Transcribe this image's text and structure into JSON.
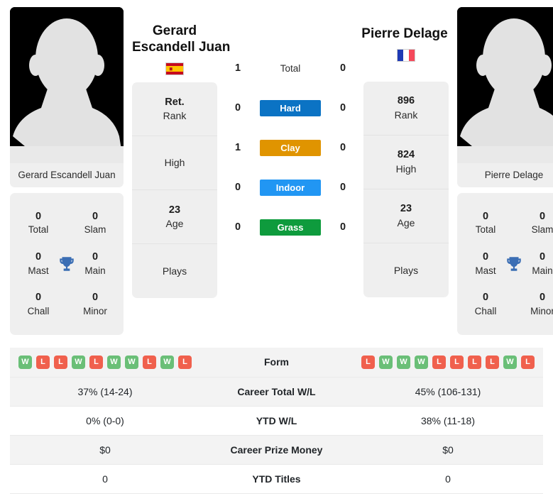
{
  "players": {
    "left": {
      "name_lines": [
        "Gerard",
        "Escandell Juan"
      ],
      "photo_caption": "Gerard Escandell Juan",
      "country": "Spain",
      "flag_icon": "spain-flag-icon",
      "rank_value": "Ret.",
      "rank_label": "Rank",
      "high_value": "",
      "high_label": "High",
      "age_value": "23",
      "age_label": "Age",
      "plays_value": "",
      "plays_label": "Plays",
      "titles": [
        {
          "num": "0",
          "label": "Total"
        },
        {
          "num": "0",
          "label": "Slam"
        },
        {
          "num": "0",
          "label": "Mast"
        },
        {
          "num": "0",
          "label": "Main"
        },
        {
          "num": "0",
          "label": "Chall"
        },
        {
          "num": "0",
          "label": "Minor"
        }
      ],
      "form": [
        "W",
        "L",
        "L",
        "W",
        "L",
        "W",
        "W",
        "L",
        "W",
        "L"
      ]
    },
    "right": {
      "name_lines": [
        "Pierre Delage"
      ],
      "photo_caption": "Pierre Delage",
      "country": "France",
      "flag_icon": "france-flag-icon",
      "rank_value": "896",
      "rank_label": "Rank",
      "high_value": "824",
      "high_label": "High",
      "age_value": "23",
      "age_label": "Age",
      "plays_value": "",
      "plays_label": "Plays",
      "titles": [
        {
          "num": "0",
          "label": "Total"
        },
        {
          "num": "0",
          "label": "Slam"
        },
        {
          "num": "0",
          "label": "Mast"
        },
        {
          "num": "0",
          "label": "Main"
        },
        {
          "num": "0",
          "label": "Chall"
        },
        {
          "num": "0",
          "label": "Minor"
        }
      ],
      "form": [
        "L",
        "W",
        "W",
        "W",
        "L",
        "L",
        "L",
        "L",
        "W",
        "L"
      ]
    }
  },
  "head_to_head": [
    {
      "left": "1",
      "label": "Total",
      "right": "0",
      "color": ""
    },
    {
      "left": "0",
      "label": "Hard",
      "right": "0",
      "color": "#0b73c4"
    },
    {
      "left": "1",
      "label": "Clay",
      "right": "0",
      "color": "#e09400"
    },
    {
      "left": "0",
      "label": "Indoor",
      "right": "0",
      "color": "#2196f3"
    },
    {
      "left": "0",
      "label": "Grass",
      "right": "0",
      "color": "#0e9b3d"
    }
  ],
  "stats_rows": [
    {
      "left": "",
      "label": "Form",
      "right": "",
      "is_form": true
    },
    {
      "left": "37% (14-24)",
      "label": "Career Total W/L",
      "right": "45% (106-131)",
      "is_form": false
    },
    {
      "left": "0% (0-0)",
      "label": "YTD W/L",
      "right": "38% (11-18)",
      "is_form": false
    },
    {
      "left": "$0",
      "label": "Career Prize Money",
      "right": "$0",
      "is_form": false
    },
    {
      "left": "0",
      "label": "YTD Titles",
      "right": "0",
      "is_form": false
    }
  ],
  "colors": {
    "win_badge": "#6abf77",
    "loss_badge": "#f0604d",
    "trophy": "#3b6eb4",
    "card_bg": "#efefef"
  },
  "icons": {
    "trophy": "trophy-icon",
    "avatar": "person-silhouette-icon"
  }
}
